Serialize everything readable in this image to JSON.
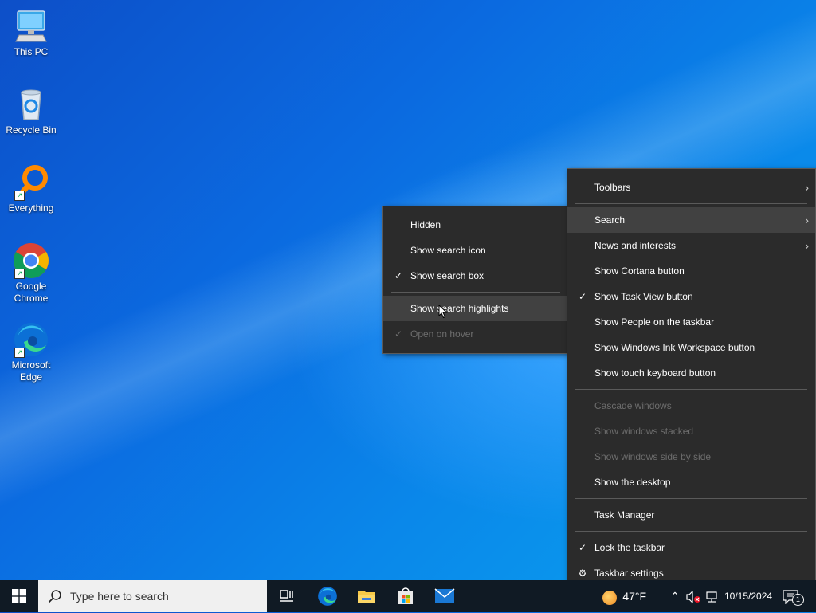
{
  "desktop": {
    "icons": [
      {
        "label": "This PC"
      },
      {
        "label": "Recycle Bin"
      },
      {
        "label": "Everything"
      },
      {
        "label": "Google Chrome"
      },
      {
        "label": "Microsoft Edge"
      }
    ]
  },
  "search_submenu": {
    "items": [
      {
        "label": "Hidden",
        "checked": false,
        "disabled": false
      },
      {
        "label": "Show search icon",
        "checked": false,
        "disabled": false
      },
      {
        "label": "Show search box",
        "checked": true,
        "disabled": false
      },
      {
        "label": "Show search highlights",
        "checked": false,
        "disabled": false,
        "hovered": true
      },
      {
        "label": "Open on hover",
        "checked": true,
        "disabled": true
      }
    ]
  },
  "taskbar_menu": {
    "items": [
      {
        "label": "Toolbars",
        "submenu": true
      },
      {
        "label": "Search",
        "submenu": true,
        "hovered": true
      },
      {
        "label": "News and interests",
        "submenu": true
      },
      {
        "label": "Show Cortana button"
      },
      {
        "label": "Show Task View button",
        "checked": true
      },
      {
        "label": "Show People on the taskbar"
      },
      {
        "label": "Show Windows Ink Workspace button"
      },
      {
        "label": "Show touch keyboard button"
      },
      {
        "label": "Cascade windows",
        "disabled": true
      },
      {
        "label": "Show windows stacked",
        "disabled": true
      },
      {
        "label": "Show windows side by side",
        "disabled": true
      },
      {
        "label": "Show the desktop"
      },
      {
        "label": "Task Manager"
      },
      {
        "label": "Lock the taskbar",
        "checked": true
      },
      {
        "label": "Taskbar settings",
        "icon": "gear-icon"
      }
    ]
  },
  "taskbar": {
    "search_placeholder": "Type here to search",
    "weather": "47°F",
    "date": "10/15/2024",
    "notification_count": "1"
  },
  "glyphs": {
    "check": "✓",
    "chevron": "›",
    "gear": "⚙",
    "search": "⚲",
    "tray_up": "⌃"
  }
}
